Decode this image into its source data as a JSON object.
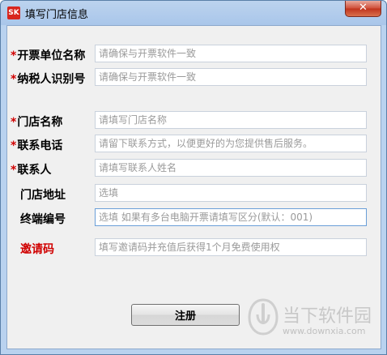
{
  "window": {
    "title": "填写门店信息",
    "close_label": "✕"
  },
  "form": {
    "rows": [
      {
        "label": "开票单位名称",
        "required": true,
        "placeholder": "请确保与开票软件一致",
        "value": ""
      },
      {
        "label": "纳税人识别号",
        "required": true,
        "placeholder": "请确保与开票软件一致",
        "value": ""
      },
      {
        "label": "门店名称",
        "required": true,
        "placeholder": "请填写门店名称",
        "value": ""
      },
      {
        "label": "联系电话",
        "required": true,
        "placeholder": "请留下联系方式，以便更好的为您提供售后服务。",
        "value": ""
      },
      {
        "label": "联系人",
        "required": true,
        "placeholder": "请填写联系人姓名",
        "value": ""
      },
      {
        "label": "门店地址",
        "required": false,
        "placeholder": "选填",
        "value": ""
      },
      {
        "label": "终端编号",
        "required": false,
        "placeholder": "选填 如果有多台电脑开票请填写区分(默认：001)",
        "value": ""
      },
      {
        "label": "邀请码",
        "required": false,
        "placeholder": "填写邀请码并充值后获得1个月免费使用权",
        "value": ""
      }
    ],
    "required_mark": "*",
    "register_label": "注册"
  },
  "watermark": {
    "text": "当下软件园",
    "url": "www.downxia.com"
  },
  "app_icon_text": "SK",
  "colors": {
    "required": "#d00000",
    "invite_label": "#d00000",
    "title_bar": "#a9c6ea"
  }
}
